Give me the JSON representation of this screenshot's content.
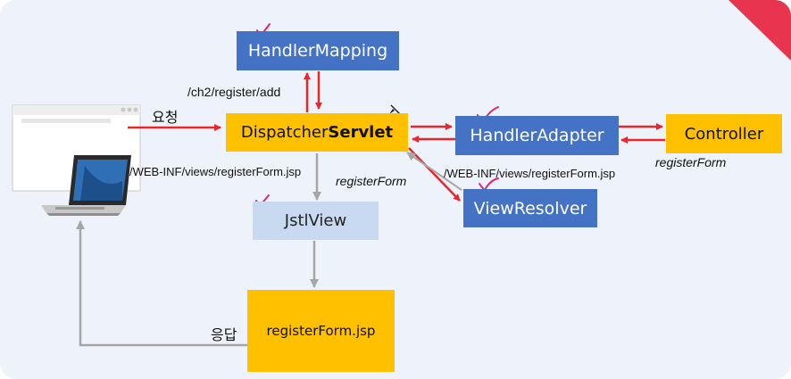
{
  "labels": {
    "handler_mapping": "HandlerMapping",
    "dispatcher_prefix": "Dispatcher",
    "dispatcher_bold": "Servlet",
    "handler_adapter": "HandlerAdapter",
    "controller": "Controller",
    "jstl_view": "JstlView",
    "view_resolver": "ViewResolver",
    "register_form_jsp": "registerForm.jsp"
  },
  "edge_labels": {
    "url": "/ch2/register/add",
    "request": "요청",
    "view_path_left": "/WEB-INF/views/registerForm.jsp",
    "view_name_center": "registerForm",
    "view_path_right": "/WEB-INF/views/registerForm.jsp",
    "view_name_controller": "registerForm",
    "response": "응답"
  },
  "colors": {
    "blue_box": "#4472c4",
    "orange_box": "#ffc000",
    "light_box": "#c8daf0",
    "red_arrow": "#e8262b",
    "gray_arrow": "#a6a6a6",
    "check_mark": "#e0247a"
  }
}
